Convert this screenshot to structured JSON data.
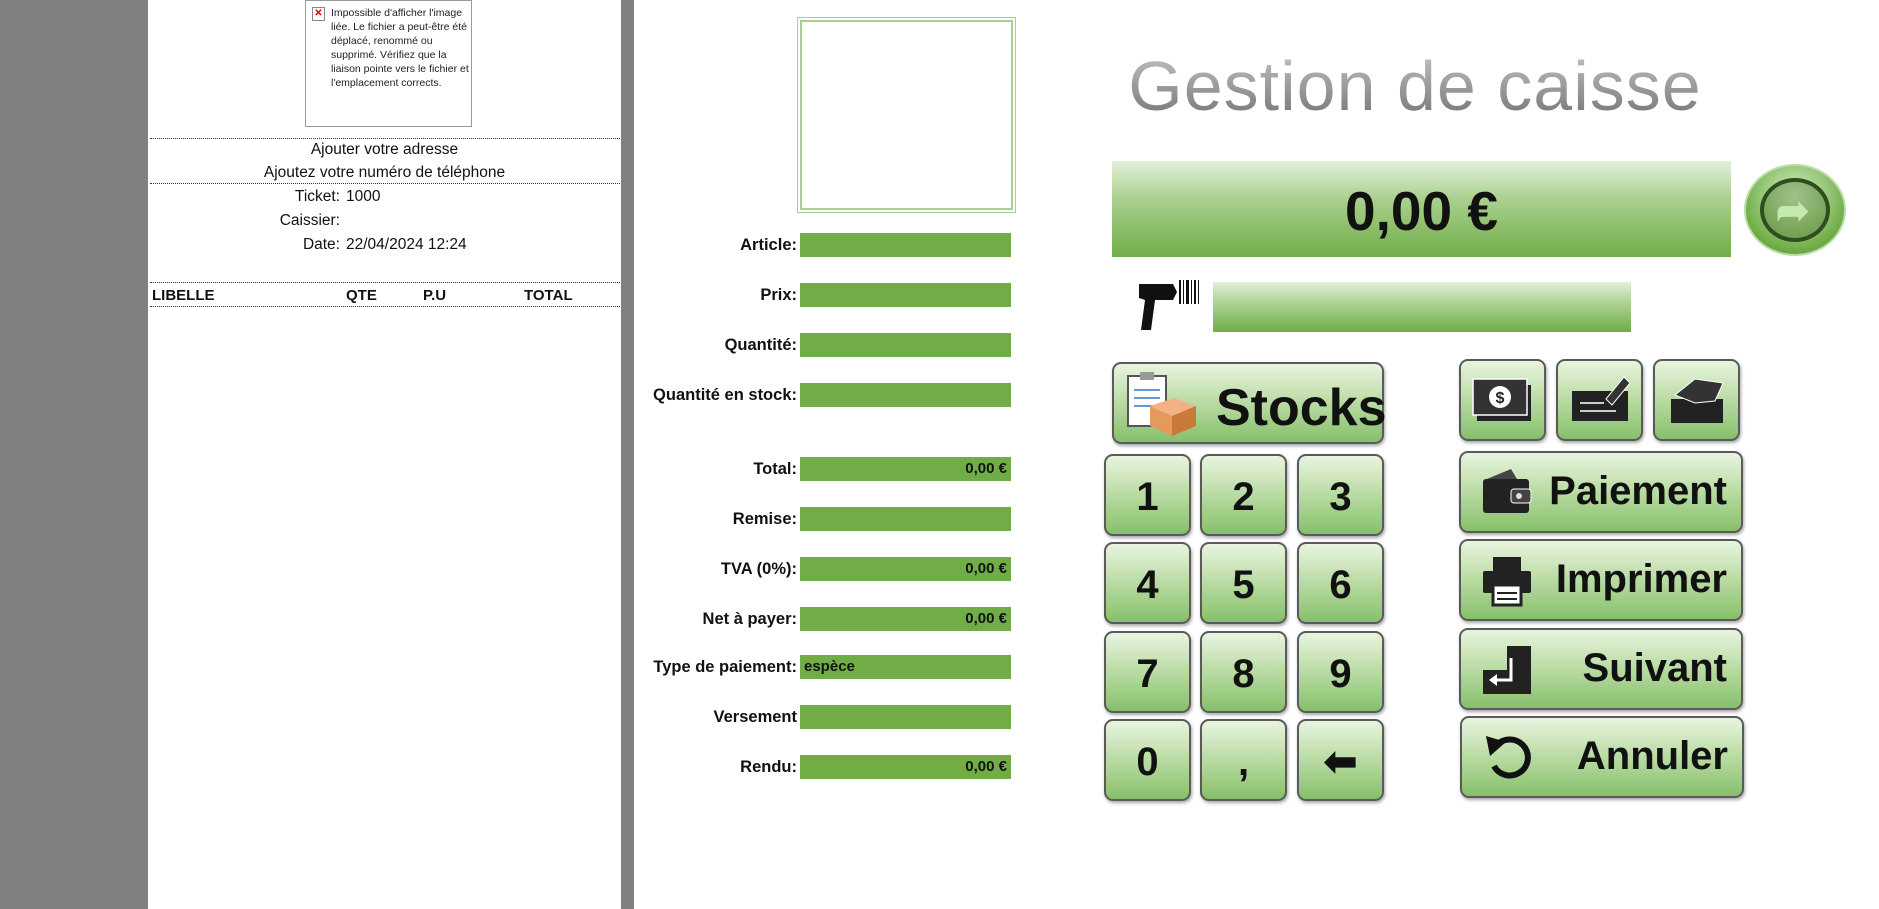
{
  "receipt": {
    "broken_image_message": "Impossible d'afficher l'image liée. Le fichier a peut-être été déplacé, renommé ou supprimé. Vérifiez que la liaison pointe vers le fichier et l'emplacement corrects.",
    "address": "Ajouter votre adresse",
    "phone": "Ajoutez votre numéro de téléphone",
    "ticket_label": "Ticket:",
    "ticket_value": "1000",
    "cashier_label": "Caissier:",
    "cashier_value": "",
    "date_label": "Date:",
    "date_value": "22/04/2024 12:24",
    "columns": [
      "LIBELLE",
      "QTE",
      "P.U",
      "TOTAL"
    ]
  },
  "form": {
    "article_label": "Article:",
    "article_value": "",
    "price_label": "Prix:",
    "price_value": "",
    "quantity_label": "Quantité:",
    "quantity_value": "",
    "stock_label": "Quantité en stock:",
    "stock_value": "",
    "total_label": "Total:",
    "total_value": "0,00 €",
    "discount_label": "Remise:",
    "discount_value": "",
    "vat_label": "TVA (0%):",
    "vat_value": "0,00 €",
    "net_label": "Net à payer:",
    "net_value": "0,00 €",
    "payment_type_label": "Type de paiement:",
    "payment_type_value": "espèce",
    "deposit_label": "Versement",
    "deposit_value": "",
    "change_label": "Rendu:",
    "change_value": "0,00 €"
  },
  "header": {
    "title": "Gestion de caisse",
    "total_display": "0,00 €"
  },
  "buttons": {
    "stocks": "Stocks",
    "keypad": [
      "1",
      "2",
      "3",
      "4",
      "5",
      "6",
      "7",
      "8",
      "9",
      "0",
      ","
    ],
    "payment": "Paiement",
    "print": "Imprimer",
    "next": "Suivant",
    "cancel": "Annuler"
  },
  "icons": {
    "back": "clock-back-icon",
    "scanner": "barcode-scanner-icon",
    "stocks": "clipboard-box-icon",
    "cash": "cash-icon",
    "check": "check-pen-icon",
    "card": "card-hand-icon",
    "wallet": "wallet-icon",
    "printer": "printer-icon",
    "enter": "enter-key-icon",
    "undo": "undo-icon",
    "backspace": "left-arrow-icon"
  },
  "colors": {
    "field_green": "#70ad47",
    "light_green": "#c3e0ae",
    "gray_band": "#808080"
  }
}
